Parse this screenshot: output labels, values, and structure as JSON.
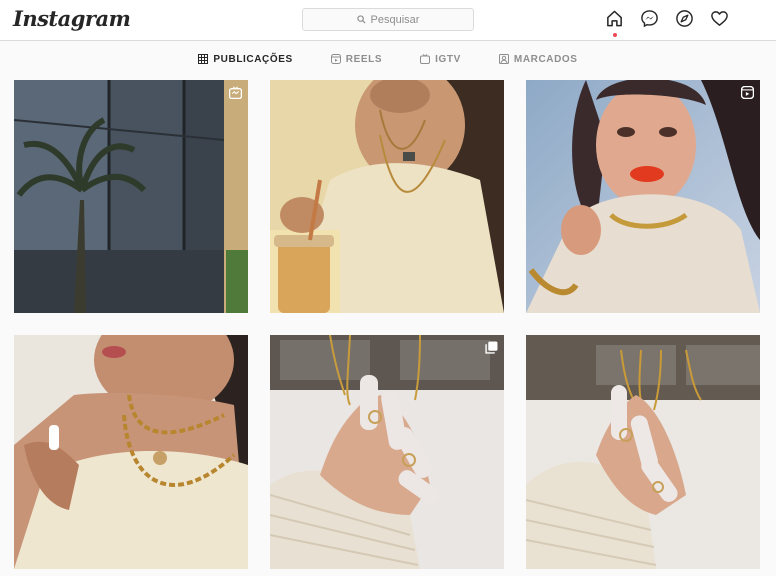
{
  "header": {
    "logo": "Instagram",
    "search_placeholder": "Pesquisar",
    "icons": [
      "home-icon",
      "messenger-icon",
      "explore-icon",
      "heart-icon"
    ]
  },
  "tabs": [
    {
      "label": "PUBLICAÇÕES",
      "icon": "grid-icon",
      "active": true
    },
    {
      "label": "REELS",
      "icon": "reels-icon",
      "active": false
    },
    {
      "label": "IGTV",
      "icon": "igtv-icon",
      "active": false
    },
    {
      "label": "MARCADOS",
      "icon": "tagged-icon",
      "active": false
    }
  ],
  "posts": [
    {
      "subject": "palm tree reflected in dark glass facade",
      "badge": "igtv-icon"
    },
    {
      "subject": "woman in cream knit top holding drink jar",
      "badge": null
    },
    {
      "subject": "woman with red lipstick and turtleneck",
      "badge": "reels-icon"
    },
    {
      "subject": "woman with gold chain necklaces",
      "badge": null
    },
    {
      "subject": "hand with rings and white nails on knit sleeve",
      "badge": "carousel-icon"
    },
    {
      "subject": "hand with rings and necklaces on display",
      "badge": null
    }
  ],
  "colors": {
    "accent_dot": "#ed4956",
    "border": "#dbdbdb",
    "muted": "#8e8e8e"
  }
}
